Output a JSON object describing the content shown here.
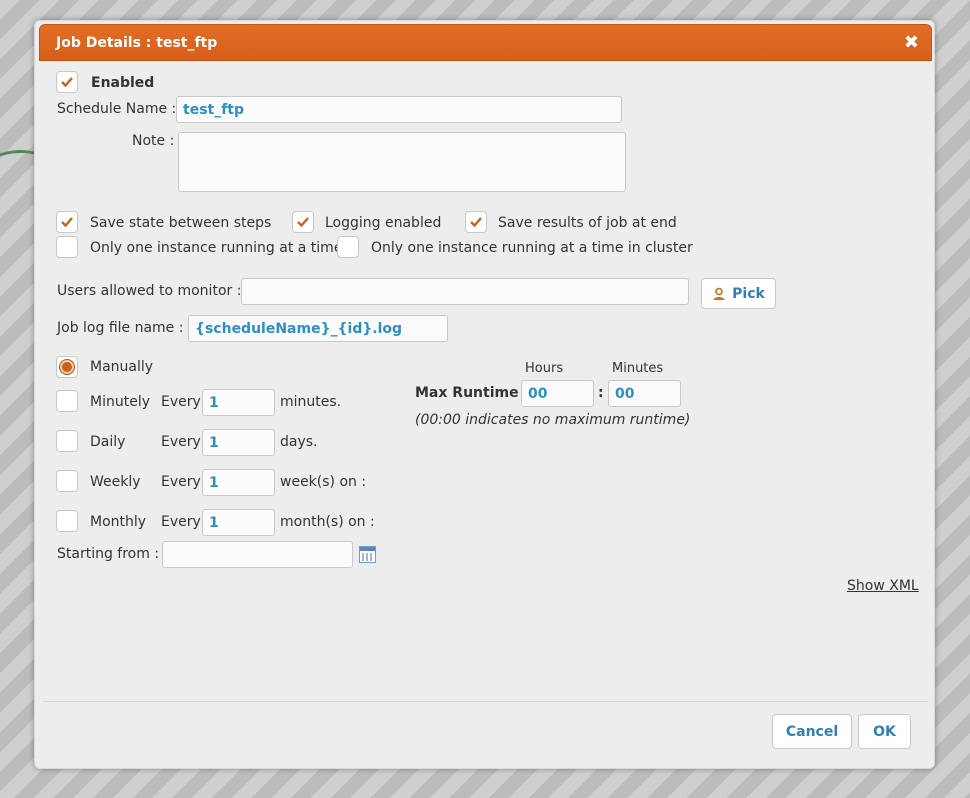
{
  "dialog": {
    "title": "Job Details : test_ftp",
    "close_glyph": "✖"
  },
  "enabled": {
    "label": "Enabled",
    "checked": true
  },
  "schedule_name": {
    "label": "Schedule Name :",
    "value": "test_ftp"
  },
  "note": {
    "label": "Note :",
    "value": ""
  },
  "options": {
    "save_state": {
      "label": "Save state between steps",
      "checked": true
    },
    "logging": {
      "label": "Logging enabled",
      "checked": true
    },
    "save_results": {
      "label": "Save results of job at end",
      "checked": true
    },
    "one_instance": {
      "label": "Only one instance running at a time",
      "checked": false
    },
    "one_instance_cluster": {
      "label": "Only one instance running at a time in cluster",
      "checked": false
    }
  },
  "users_monitor": {
    "label": "Users allowed to monitor :",
    "value": "",
    "pick_label": "Pick"
  },
  "log_file": {
    "label": "Job log file name :",
    "value": "{scheduleName}_{id}.log"
  },
  "schedule": {
    "manually": {
      "label": "Manually",
      "selected": true
    },
    "every_label": "Every",
    "minutely": {
      "label": "Minutely",
      "value": "1",
      "unit": "minutes."
    },
    "daily": {
      "label": "Daily",
      "value": "1",
      "unit": "days."
    },
    "weekly": {
      "label": "Weekly",
      "value": "1",
      "unit": "week(s) on :"
    },
    "monthly": {
      "label": "Monthly",
      "value": "1",
      "unit": "month(s) on :"
    },
    "starting_from": {
      "label": "Starting from :",
      "value": ""
    }
  },
  "max_runtime": {
    "label": "Max Runtime :",
    "hours_header": "Hours",
    "minutes_header": "Minutes",
    "hours": "00",
    "minutes": "00",
    "separator": ":",
    "hint": "(00:00 indicates no maximum runtime)"
  },
  "show_xml": "Show XML",
  "footer": {
    "cancel": "Cancel",
    "ok": "OK"
  },
  "colors": {
    "accent": "#d85f1a",
    "link_blue": "#2e7fb2",
    "check": "#c4621f"
  }
}
